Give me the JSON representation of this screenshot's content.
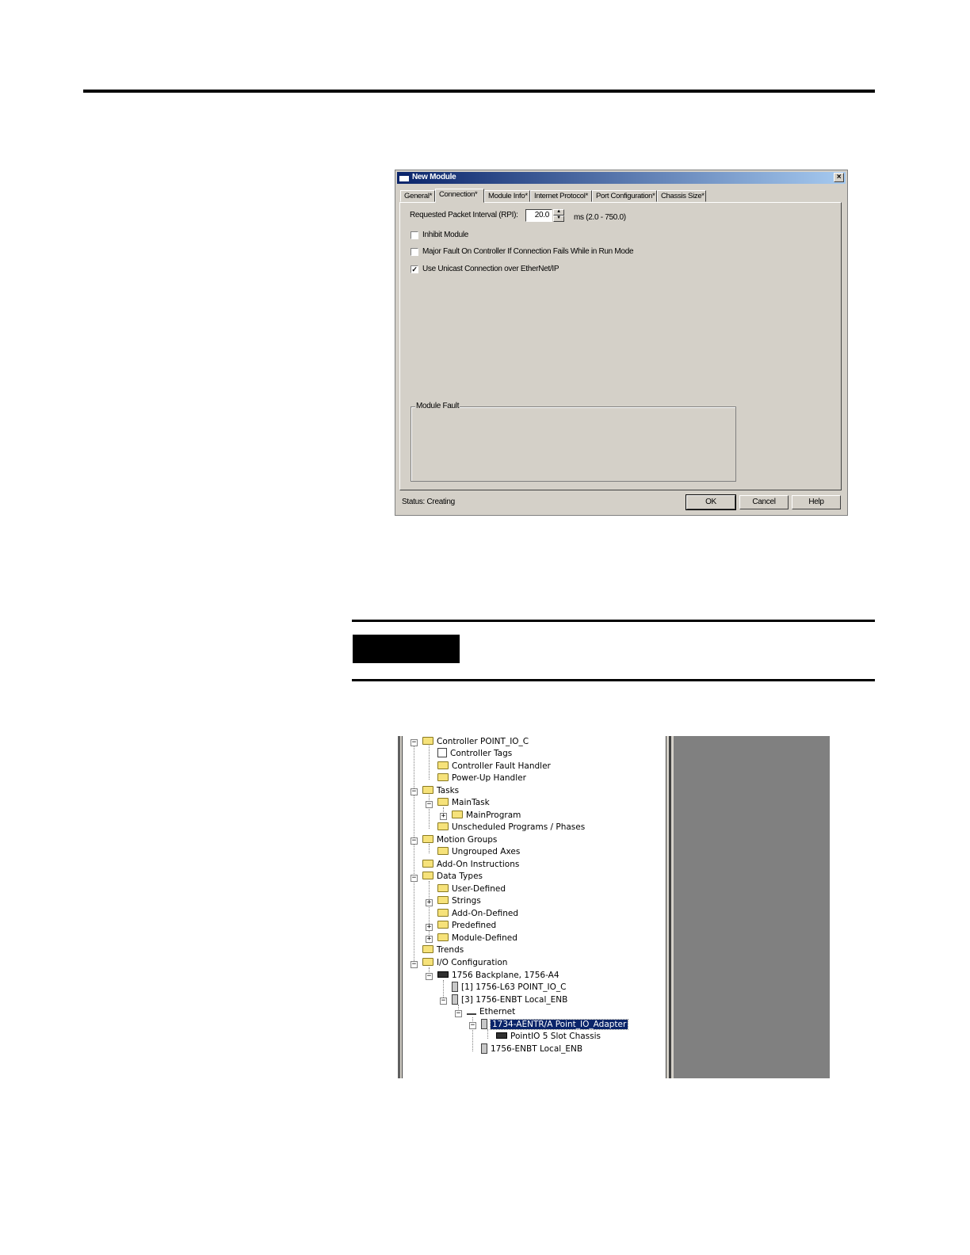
{
  "dialog": {
    "title": "New Module",
    "close": "×",
    "tabs": [
      "General*",
      "Connection*",
      "Module Info*",
      "Internet Protocol*",
      "Port Configuration*",
      "Chassis Size*"
    ],
    "rpi_label": "Requested Packet Interval (RPI):",
    "rpi_value": "20.0",
    "rpi_range": "ms (2.0 - 750.0)",
    "spin_up": "▲",
    "spin_down": "▼",
    "checkboxes": [
      {
        "label": "Inhibit Module",
        "checked": false
      },
      {
        "label": "Major Fault On Controller If Connection Fails While in Run Mode",
        "checked": false
      },
      {
        "label": "Use Unicast Connection over EtherNet/IP",
        "checked": true
      }
    ],
    "check_mark": "✓",
    "module_fault_label": "Module Fault",
    "status": "Status:  Creating",
    "buttons": {
      "ok": "OK",
      "cancel": "Cancel",
      "help": "Help"
    }
  },
  "tree": {
    "minus": "−",
    "plus": "+",
    "nodes": [
      {
        "label": "Controller POINT_IO_C"
      },
      {
        "label": "Controller Tags"
      },
      {
        "label": "Controller Fault Handler"
      },
      {
        "label": "Power-Up Handler"
      },
      {
        "label": "Tasks"
      },
      {
        "label": "MainTask"
      },
      {
        "label": "MainProgram"
      },
      {
        "label": "Unscheduled Programs / Phases"
      },
      {
        "label": "Motion Groups"
      },
      {
        "label": "Ungrouped Axes"
      },
      {
        "label": "Add-On Instructions"
      },
      {
        "label": "Data Types"
      },
      {
        "label": "User-Defined"
      },
      {
        "label": "Strings"
      },
      {
        "label": "Add-On-Defined"
      },
      {
        "label": "Predefined"
      },
      {
        "label": "Module-Defined"
      },
      {
        "label": "Trends"
      },
      {
        "label": "I/O Configuration"
      },
      {
        "label": "1756 Backplane, 1756-A4"
      },
      {
        "label": "[1] 1756-L63 POINT_IO_C"
      },
      {
        "label": "[3] 1756-ENBT Local_ENB"
      },
      {
        "label": "Ethernet"
      },
      {
        "label": "1734-AENTR/A Point_IO_Adapter"
      },
      {
        "label": "PointIO 5 Slot Chassis"
      },
      {
        "label": "1756-ENBT Local_ENB"
      }
    ]
  }
}
